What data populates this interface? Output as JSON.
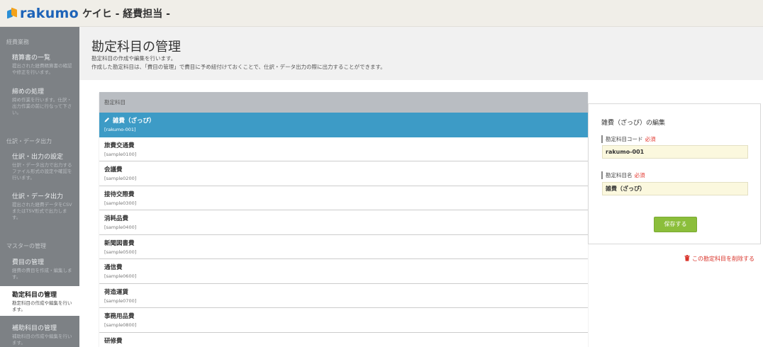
{
  "header": {
    "brand": "rakumo",
    "app_name": "ケイヒ - 経費担当 -"
  },
  "sidebar": {
    "sections": [
      {
        "label": "経費業務"
      },
      {
        "label": "仕訳・データ出力"
      },
      {
        "label": "マスターの管理"
      }
    ],
    "items": [
      {
        "title": "精算書の一覧",
        "desc": "提出された経費精算書の確認や修正を行います。"
      },
      {
        "title": "締めの処理",
        "desc": "締め作業を行います。仕訳・出力作業の前に行なって下さい。"
      },
      {
        "title": "仕訳・出力の設定",
        "desc": "仕訳・データ出力で出力するファイル形式の設定や確認を行います。"
      },
      {
        "title": "仕訳・データ出力",
        "desc": "提出された経費データをCSVまたはTSV形式で出力します。"
      },
      {
        "title": "費目の管理",
        "desc": "経費の費目を作成・編集します。"
      },
      {
        "title": "勘定科目の管理",
        "desc": "勘定科目の作成や編集を行います。"
      },
      {
        "title": "補助科目の管理",
        "desc": "補助科目の作成や編集を行います。"
      }
    ]
  },
  "page": {
    "title": "勘定科目の管理",
    "desc1": "勘定科目の作成や編集を行います。",
    "desc2": "作成した勘定科目は、「費目の管理」で費目に予め紐付けておくことで、仕訳・データ出力の際に出力することができます。"
  },
  "list": {
    "header": "勘定科目",
    "rows": [
      {
        "name": "雑費（ざっぴ）",
        "code": "[rakumo-001]"
      },
      {
        "name": "旅費交通費",
        "code": "[sample0100]"
      },
      {
        "name": "会議費",
        "code": "[sample0200]"
      },
      {
        "name": "接待交際費",
        "code": "[sample0300]"
      },
      {
        "name": "消耗品費",
        "code": "[sample0400]"
      },
      {
        "name": "新聞図書費",
        "code": "[sample0500]"
      },
      {
        "name": "通信費",
        "code": "[sample0600]"
      },
      {
        "name": "荷造運賃",
        "code": "[sample0700]"
      },
      {
        "name": "事務用品費",
        "code": "[sample0800]"
      },
      {
        "name": "研修費",
        "code": ""
      }
    ]
  },
  "edit": {
    "title": "雑費（ざっぴ）の編集",
    "code_label": "勘定科目コード",
    "code_required": "必須",
    "code_value": "rakumo-001",
    "name_label": "勘定科目名",
    "name_required": "必須",
    "name_value": "雑費（ざっぴ）",
    "save_label": "保存する",
    "delete_label": "この勘定科目を削除する"
  },
  "colors": {
    "accent": "#3d9bc6",
    "sidebar": "#7d8185",
    "save": "#8bbe3b",
    "danger": "#d9342b",
    "brand": "#1d63b8"
  },
  "icons": {
    "selected_row": "pencil-icon",
    "delete": "trash-icon",
    "logo": "rakumo-logo-icon"
  }
}
